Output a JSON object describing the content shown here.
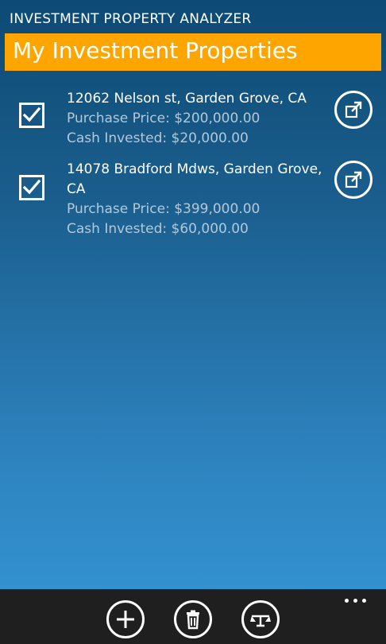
{
  "app": {
    "title": "INVESTMENT PROPERTY ANALYZER"
  },
  "page": {
    "title": "My Investment Properties"
  },
  "properties": [
    {
      "checked": true,
      "address": "12062 Nelson st, Garden Grove, CA",
      "purchase_price": "Purchase Price: $200,000.00",
      "cash_invested": "Cash Invested: $20,000.00"
    },
    {
      "checked": true,
      "address": "14078 Bradford Mdws, Garden Grove, CA",
      "purchase_price": "Purchase Price: $399,000.00",
      "cash_invested": "Cash Invested: $60,000.00"
    }
  ],
  "appbar": {
    "buttons": [
      {
        "icon": "add-icon"
      },
      {
        "icon": "delete-icon"
      },
      {
        "icon": "compare-icon"
      }
    ],
    "more_icon": "more-icon"
  },
  "colors": {
    "accent": "#ffa500",
    "background_top": "#0d4a74",
    "background_bottom": "#3597d6",
    "appbar": "#1f1f1f",
    "secondary_text": "#b3c9da"
  }
}
